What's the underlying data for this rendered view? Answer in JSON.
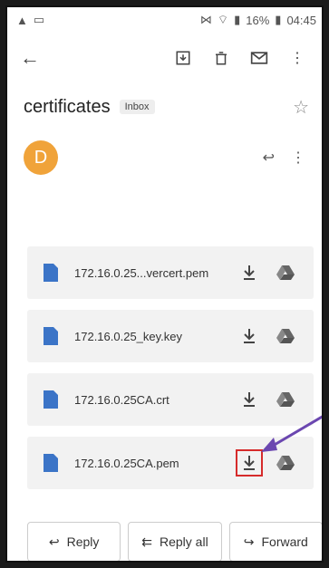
{
  "status": {
    "time": "04:45",
    "battery": "16%"
  },
  "message": {
    "subject": "certificates",
    "label": "Inbox",
    "sender_initial": "D"
  },
  "attachments": [
    {
      "name": "172.16.0.25...vercert.pem"
    },
    {
      "name": "172.16.0.25_key.key"
    },
    {
      "name": "172.16.0.25CA.crt"
    },
    {
      "name": "172.16.0.25CA.pem"
    }
  ],
  "actions": {
    "reply": "Reply",
    "reply_all": "Reply all",
    "forward": "Forward"
  },
  "colors": {
    "avatar": "#f0a33a",
    "file_icon": "#3b74c7",
    "highlight": "#d62b2b",
    "arrow": "#6b47b0"
  },
  "icons": [
    "back-arrow-icon",
    "archive-icon",
    "trash-icon",
    "mail-icon",
    "overflow-icon",
    "star-icon",
    "reply-icon",
    "file-icon",
    "download-icon",
    "drive-icon",
    "reply-all-icon",
    "forward-icon"
  ]
}
